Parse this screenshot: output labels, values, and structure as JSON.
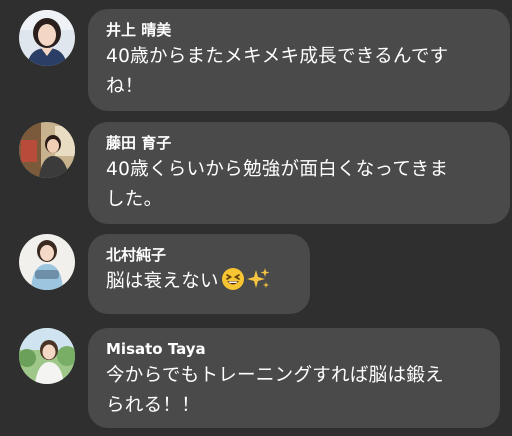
{
  "comments": [
    {
      "author": "井上 晴美",
      "avatar_icon": "profile-photo-woman-dark-hair",
      "lines": [
        "40歳からまたメキメキ成長できるんです",
        "ね！"
      ]
    },
    {
      "author": "藤田 育子",
      "avatar_icon": "profile-photo-woman-indoor",
      "lines": [
        "40歳くらいから勉強が面白くなってきま",
        "した。"
      ]
    },
    {
      "author": "北村純子",
      "avatar_icon": "profile-photo-woman-light-blue-top",
      "lines": [
        "脳は衰えない"
      ],
      "emojis": [
        "grinning-squinting-face-emoji",
        "sparkles-emoji"
      ]
    },
    {
      "author": "Misato Taya",
      "avatar_icon": "profile-photo-woman-outdoor",
      "lines": [
        "今からでもトレーニングすれば脳は鍛え",
        "られる！！"
      ]
    }
  ],
  "colors": {
    "background": "#2f2f2f",
    "bubble": "#4a4a4a",
    "text": "#ffffff"
  }
}
